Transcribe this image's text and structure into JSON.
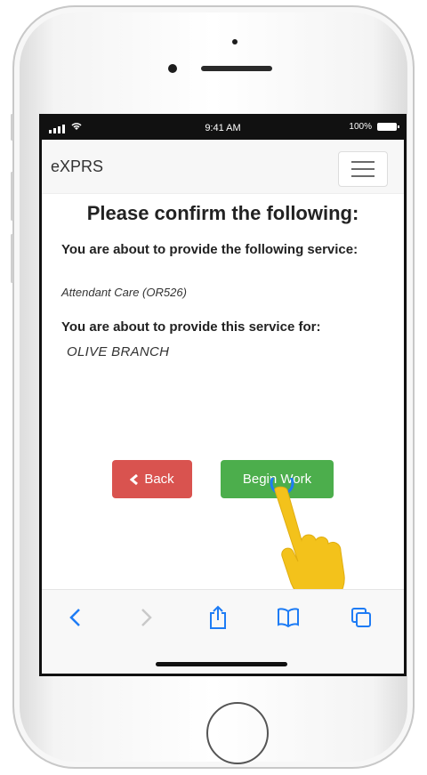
{
  "status_bar": {
    "time": "9:41 AM",
    "battery": "100%"
  },
  "navbar": {
    "brand": "eXPRS",
    "menu_icon": "hamburger-menu-icon"
  },
  "confirm": {
    "title": "Please confirm the following:",
    "service_label_part1": "You are about to",
    "service_label_part2": "provide the following service:",
    "service_value": "Attendant Care (OR526)",
    "client_label": "You are about to provide this service for:",
    "client_value": "OLIVE BRANCH"
  },
  "buttons": {
    "back_label": "Back",
    "begin_label": "Begin Work"
  },
  "toolbar": {
    "icons": [
      "back-arrow-icon",
      "forward-arrow-icon",
      "share-icon",
      "bookmarks-icon",
      "tabs-icon"
    ]
  },
  "colors": {
    "back_button": "#d9534f",
    "begin_button": "#4cae4c",
    "toolbar_icon": "#1e7cf5",
    "hand": "#f3c21b"
  }
}
